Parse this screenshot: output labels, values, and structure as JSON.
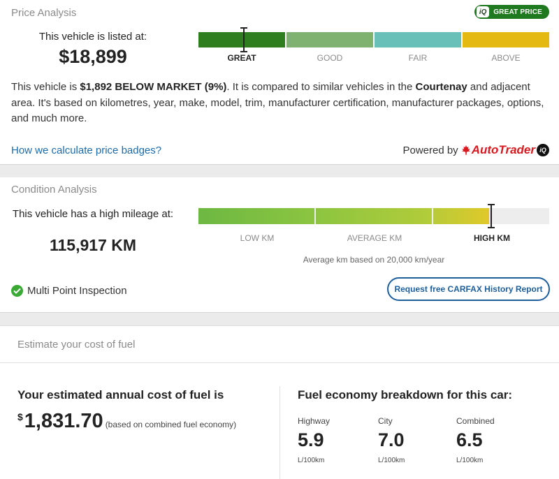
{
  "price_analysis": {
    "title": "Price Analysis",
    "badge": {
      "iq": "iQ",
      "label": "GREAT PRICE",
      "color": "#1f7a1f"
    },
    "listed_label": "This vehicle is listed at:",
    "price": "$18,899",
    "bar": [
      {
        "label": "GREAT",
        "color": "#2e7d1e",
        "active": true
      },
      {
        "label": "GOOD",
        "color": "#7fb271",
        "active": false
      },
      {
        "label": "FAIR",
        "color": "#68c0b8",
        "active": false
      },
      {
        "label": "ABOVE",
        "color": "#e4ba12",
        "active": false
      }
    ],
    "marker_segment": "GREAT",
    "desc": {
      "p1": "This vehicle is ",
      "b1": "$1,892 BELOW MARKET (9%)",
      "p2": ". It is compared to similar vehicles in the ",
      "b2": "Courtenay",
      "p3": " and adjacent area. It's based on kilometres, year, make, model, trim, manufacturer certification, manufacturer packages, options, and much more."
    },
    "calc_link": "How we calculate price badges?",
    "powered_by": "Powered by",
    "brand": "AutoTrader",
    "brand_iq": "iQ"
  },
  "condition_analysis": {
    "title": "Condition Analysis",
    "mileage_label": "This vehicle has a high mileage at:",
    "mileage": "115,917 KM",
    "segments": [
      {
        "label": "LOW KM",
        "active": false
      },
      {
        "label": "AVERAGE KM",
        "active": false
      },
      {
        "label": "HIGH KM",
        "active": true
      }
    ],
    "marker_fraction": 0.83,
    "note": "Average km based on 20,000 km/year",
    "inspection": "Multi Point Inspection",
    "carfax_button": "Request free CARFAX History Report"
  },
  "fuel": {
    "title": "Estimate your cost of fuel",
    "annual_heading": "Your estimated annual cost of fuel is",
    "currency": "$",
    "annual_cost": "1,831.70",
    "annual_note": "(based on combined fuel economy)",
    "breakdown_heading": "Fuel economy breakdown for this car:",
    "economy": [
      {
        "label": "Highway",
        "value": "5.9",
        "unit": "L/100km"
      },
      {
        "label": "City",
        "value": "7.0",
        "unit": "L/100km"
      },
      {
        "label": "Combined",
        "value": "6.5",
        "unit": "L/100km"
      }
    ]
  }
}
